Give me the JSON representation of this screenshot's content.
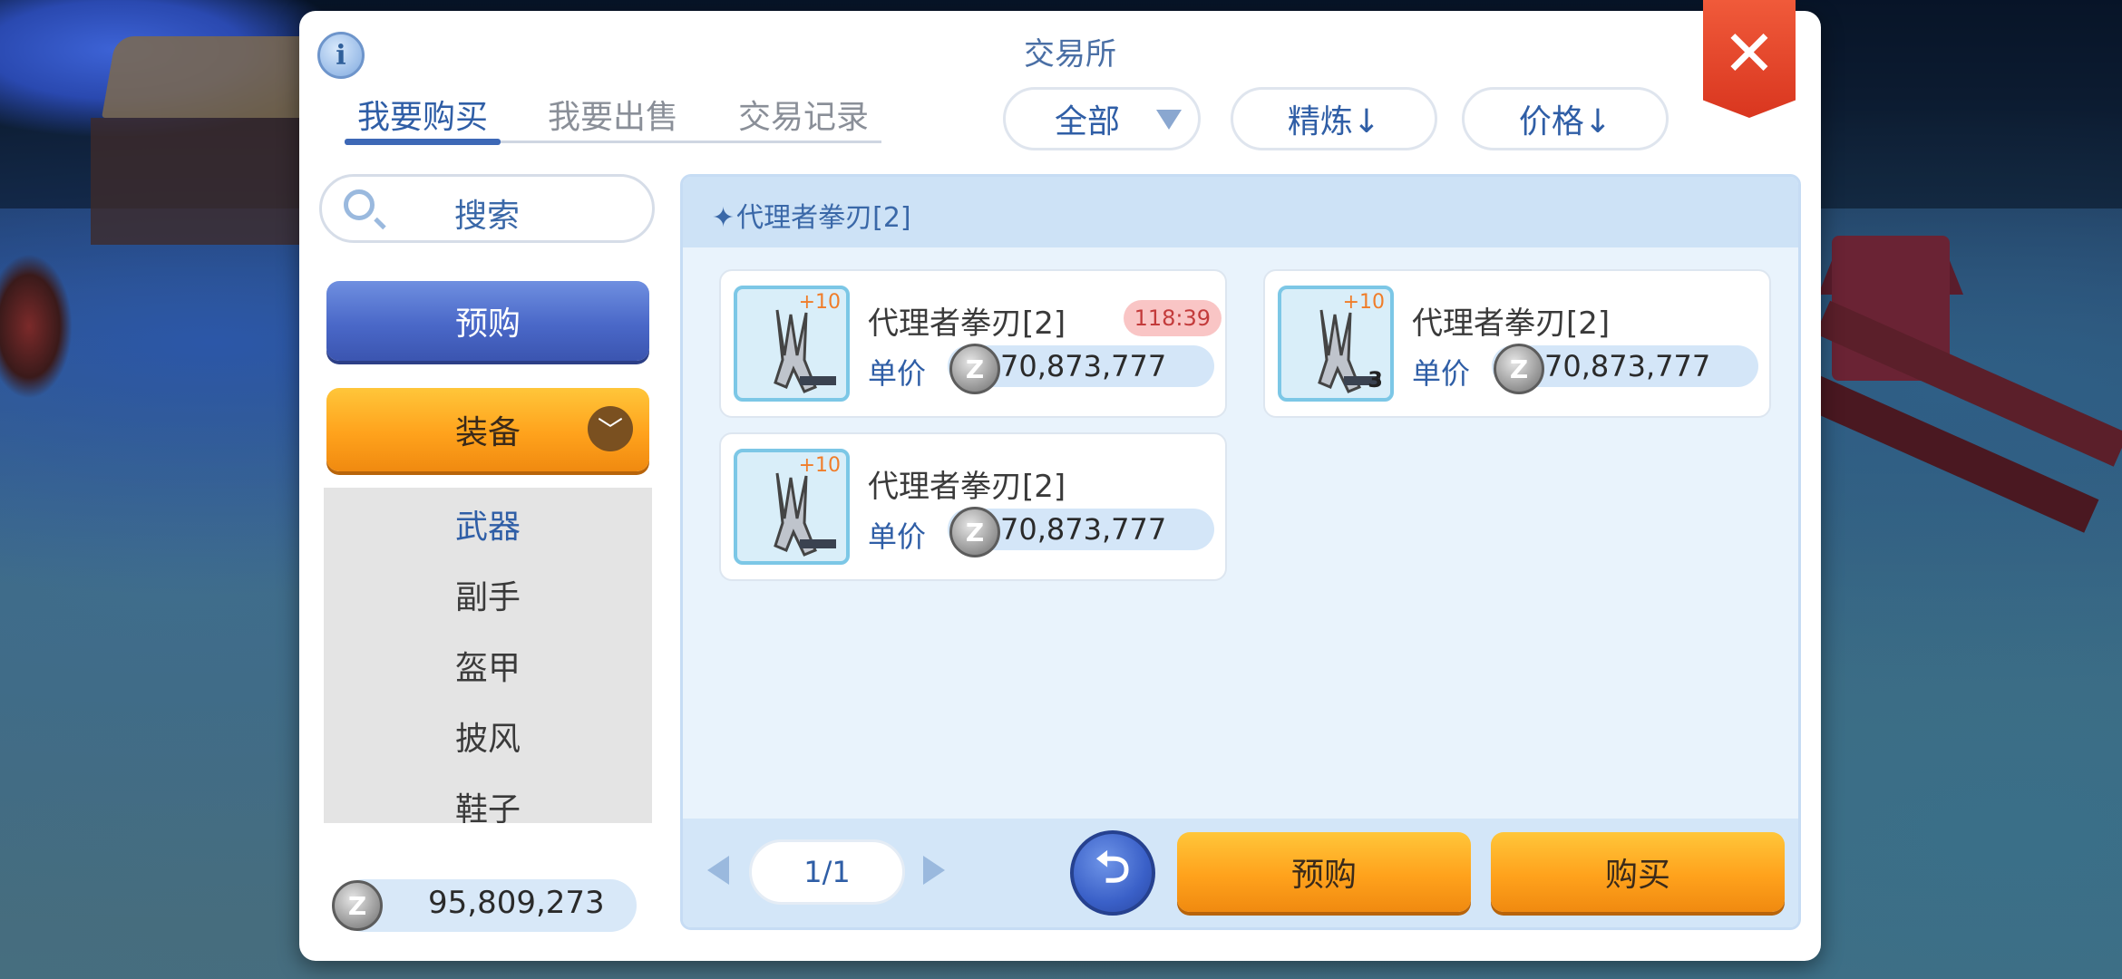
{
  "window": {
    "title": "交易所",
    "close_icon": "close-icon",
    "info_icon": "info-icon"
  },
  "tabs": [
    {
      "label": "我要购买",
      "active": true
    },
    {
      "label": "我要出售",
      "active": false
    },
    {
      "label": "交易记录",
      "active": false
    }
  ],
  "filters": {
    "type": {
      "selected": "全部"
    },
    "refine_sort": "精炼↓",
    "price_sort": "价格↓"
  },
  "sidebar": {
    "search_label": "搜索",
    "preorder_label": "预购",
    "category_label": "装备",
    "subcategories": [
      {
        "label": "武器",
        "active": true
      },
      {
        "label": "副手",
        "active": false
      },
      {
        "label": "盔甲",
        "active": false
      },
      {
        "label": "披风",
        "active": false
      },
      {
        "label": "鞋子",
        "active": false
      }
    ],
    "balance": "95,809,273"
  },
  "listing": {
    "title": "代理者拳刃[2]",
    "items": [
      {
        "name": "代理者拳刃[2]",
        "refine": "+10",
        "timer": "118:39",
        "unit_label": "单价",
        "price": "70,873,777",
        "qty": ""
      },
      {
        "name": "代理者拳刃[2]",
        "refine": "+10",
        "timer": "",
        "unit_label": "单价",
        "price": "70,873,777",
        "qty": "3"
      },
      {
        "name": "代理者拳刃[2]",
        "refine": "+10",
        "timer": "",
        "unit_label": "单价",
        "price": "70,873,777",
        "qty": ""
      }
    ]
  },
  "pagination": {
    "label": "1/1"
  },
  "actions": {
    "preorder_label": "预购",
    "buy_label": "购买"
  },
  "colors": {
    "accent": "#2f5ea6",
    "orange_button": "#ffa21c",
    "blue_button": "#4a68c8",
    "close": "#d9361f"
  },
  "zeny_glyph": "Z"
}
